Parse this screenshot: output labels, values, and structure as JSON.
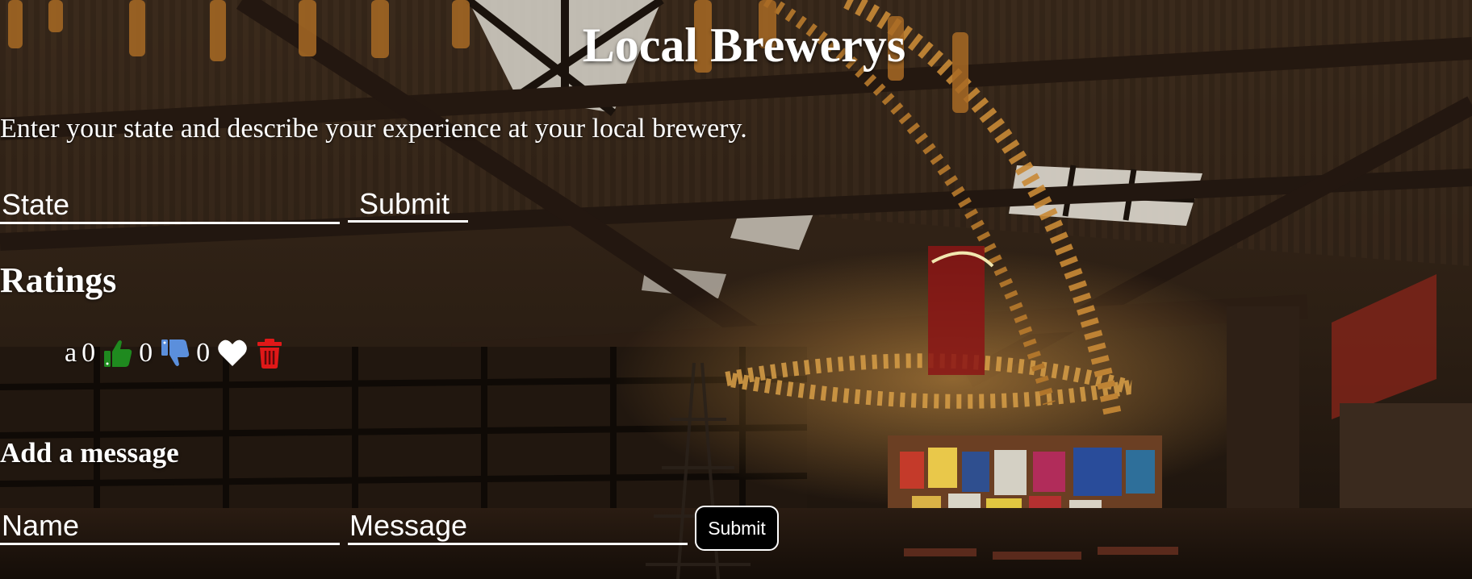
{
  "header": {
    "title": "Local Brewerys"
  },
  "intro": {
    "text": "Enter your state and describe your experience at your local brewery."
  },
  "state_form": {
    "state_placeholder": "State",
    "submit_label": "Submit"
  },
  "ratings": {
    "heading": "Ratings",
    "items": [
      {
        "name": "a",
        "likes": "0",
        "dislikes": "0",
        "hearts": "0",
        "icons": [
          "thumbs-up-icon",
          "thumbs-down-icon",
          "heart-icon",
          "trash-icon"
        ]
      }
    ]
  },
  "message_form": {
    "heading": "Add a message",
    "name_placeholder": "Name",
    "message_placeholder": "Message",
    "submit_label": "Submit"
  },
  "colors": {
    "thumbs_up": "#1f8a1f",
    "thumbs_down": "#5b8fdc",
    "heart": "#ffffff",
    "trash": "#e01818",
    "text": "#ffffff"
  }
}
